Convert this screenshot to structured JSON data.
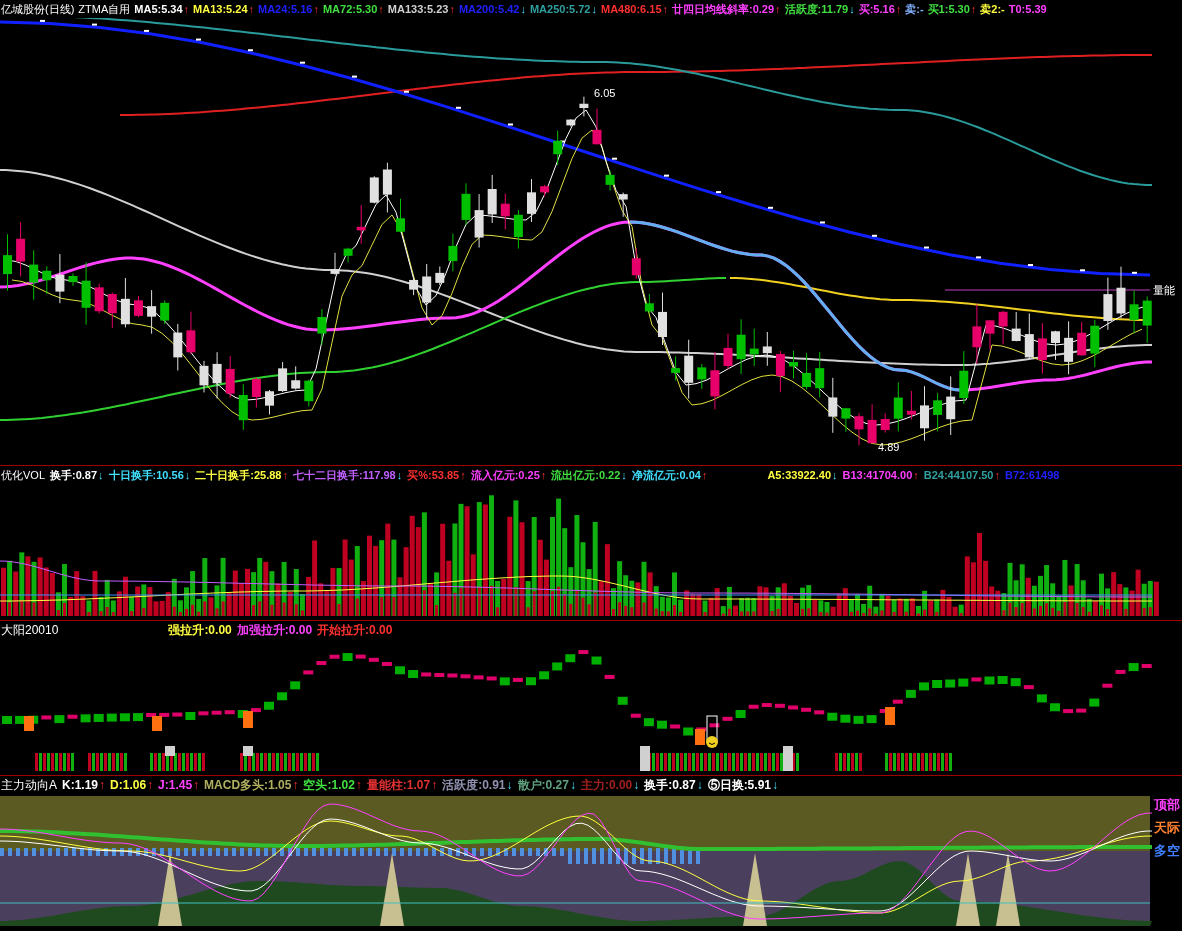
{
  "main": {
    "title": "亿城股份(日线)",
    "subtitle": "ZTMA自用",
    "items": [
      {
        "text": "MA5:5.34",
        "arrow": "↑",
        "rising": true,
        "color": "#ffffff"
      },
      {
        "text": "MA13:5.24",
        "arrow": "↑",
        "rising": true,
        "color": "#ffff40"
      },
      {
        "text": "MA24:5.16",
        "arrow": "↑",
        "rising": true,
        "color": "#2020ff"
      },
      {
        "text": "MA72:5.30",
        "arrow": "↑",
        "rising": true,
        "color": "#40e040"
      },
      {
        "text": "MA133:5.23",
        "arrow": "↑",
        "rising": true,
        "color": "#d0d0d0"
      },
      {
        "text": "MA200:5.42",
        "arrow": "↓",
        "rising": false,
        "color": "#2020ff"
      },
      {
        "text": "MA250:5.72",
        "arrow": "↓",
        "rising": false,
        "color": "#30a0a0"
      },
      {
        "text": "MA480:6.15",
        "arrow": "↑",
        "rising": true,
        "color": "#ff3030"
      },
      {
        "text": "廿四日均线斜率:0.29",
        "arrow": "↑",
        "rising": true,
        "color": "#ff40ff"
      },
      {
        "text": "活跃度:11.79",
        "arrow": "↓",
        "rising": false,
        "color": "#40e040"
      },
      {
        "text": "买:5.16",
        "arrow": "↑",
        "rising": true,
        "color": "#ff40ff"
      },
      {
        "text": "卖:-",
        "color": "#80b0ff"
      },
      {
        "text": "买1:5.30",
        "arrow": "↑",
        "rising": true,
        "color": "#40e040"
      },
      {
        "text": "卖2:-",
        "color": "#ffff40"
      },
      {
        "text": "T0:5.39",
        "color": "#ff40ff"
      }
    ],
    "annotations": [
      {
        "kind": "high",
        "text": "6.05"
      },
      {
        "kind": "low",
        "text": "4.89"
      },
      {
        "kind": "edge",
        "text": "量能"
      }
    ]
  },
  "volume": {
    "title": "优化VOL",
    "items": [
      {
        "text": "换手:0.87",
        "arrow": "↓",
        "rising": false,
        "color": "#ffffff"
      },
      {
        "text": "十日换手:10.56",
        "arrow": "↓",
        "rising": false,
        "color": "#40e0ff"
      },
      {
        "text": "二十日换手:25.88",
        "arrow": "↑",
        "rising": true,
        "color": "#ffff40"
      },
      {
        "text": "七十二日换手:117.98",
        "arrow": "↓",
        "rising": false,
        "color": "#c060ff"
      },
      {
        "text": "买%:53.85",
        "arrow": "↑",
        "rising": true,
        "color": "#ff3030"
      },
      {
        "text": "流入亿元:0.25",
        "arrow": "↑",
        "rising": true,
        "color": "#ff40ff"
      },
      {
        "text": "流出亿元:0.22",
        "arrow": "↓",
        "rising": false,
        "color": "#40e040"
      },
      {
        "text": "净流亿元:0.04",
        "arrow": "↑",
        "rising": true,
        "color": "#40e0ff"
      }
    ],
    "right_items": [
      {
        "text": "A5:33922.40",
        "arrow": "↓",
        "rising": false,
        "color": "#ffff40"
      },
      {
        "text": "B13:41704.00",
        "arrow": "↑",
        "rising": true,
        "color": "#ff40ff"
      },
      {
        "text": "B24:44107.50",
        "arrow": "↑",
        "rising": true,
        "color": "#30a0a0"
      },
      {
        "text": "B72:61498",
        "color": "#2020ff"
      }
    ]
  },
  "signal": {
    "title": "大阳20010",
    "items": [
      {
        "text": "强拉升:0.00",
        "color": "#ffff40"
      },
      {
        "text": "加强拉升:0.00",
        "color": "#ff40ff"
      },
      {
        "text": "开始拉升:0.00",
        "color": "#ff3030"
      }
    ]
  },
  "trend": {
    "title": "主力动向A",
    "items": [
      {
        "text": "K:1.19",
        "arrow": "↑",
        "rising": true,
        "color": "#ffffff"
      },
      {
        "text": "D:1.06",
        "arrow": "↑",
        "rising": true,
        "color": "#ffff40"
      },
      {
        "text": "J:1.45",
        "arrow": "↑",
        "rising": true,
        "color": "#ff40ff"
      },
      {
        "text": "MACD多头:1.05",
        "arrow": "↑",
        "rising": true,
        "color": "#b0b060"
      },
      {
        "text": "空头:1.02",
        "arrow": "↑",
        "rising": true,
        "color": "#40e040"
      },
      {
        "text": "量能柱:1.07",
        "arrow": "↑",
        "rising": true,
        "color": "#e03030"
      },
      {
        "text": "活跃度:0.91",
        "arrow": "↓",
        "rising": false,
        "color": "#9090b0"
      },
      {
        "text": "散户:0.27",
        "arrow": "↓",
        "rising": false,
        "color": "#60a080"
      },
      {
        "text": "主力:0.00",
        "arrow": "↓",
        "rising": false,
        "color": "#a02020"
      },
      {
        "text": "换手:0.87",
        "arrow": "↓",
        "rising": false,
        "color": "#ffffff"
      },
      {
        "text": "⑤日换:5.91",
        "arrow": "↓",
        "rising": false,
        "color": "#ffffff"
      }
    ],
    "edge_labels": [
      {
        "text": "顶部",
        "color": "#ff40ff"
      },
      {
        "text": "天际",
        "color": "#ff8030"
      },
      {
        "text": "多空",
        "color": "#4080ff"
      }
    ]
  }
}
